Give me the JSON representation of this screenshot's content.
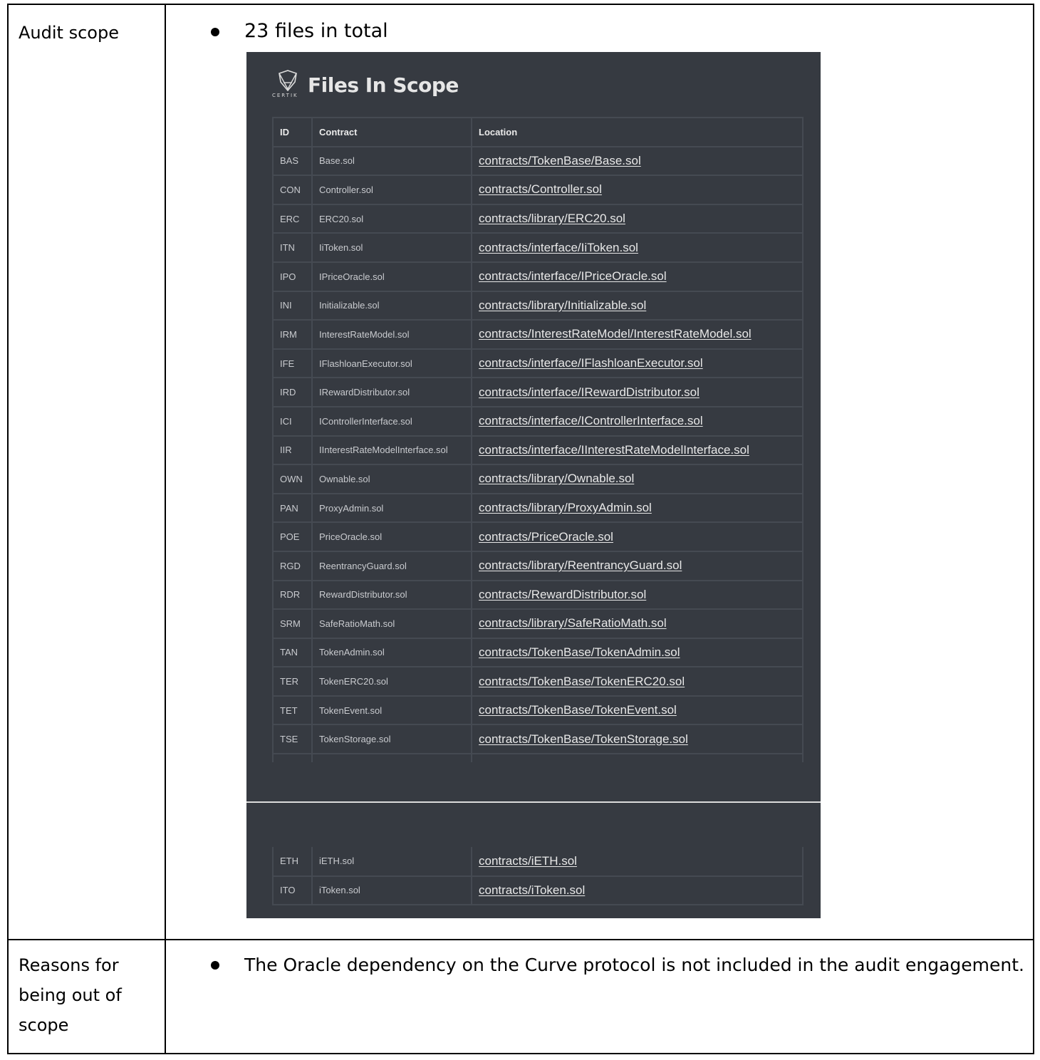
{
  "audit_scope": {
    "label": "Audit scope",
    "bullet": "23 files in total",
    "image": {
      "logo_text": "CERTIK",
      "title": "Files In Scope",
      "headers": [
        "ID",
        "Contract",
        "Location"
      ],
      "rows": [
        {
          "id": "BAS",
          "contract": "Base.sol",
          "location": "contracts/TokenBase/Base.sol"
        },
        {
          "id": "CON",
          "contract": "Controller.sol",
          "location": "contracts/Controller.sol"
        },
        {
          "id": "ERC",
          "contract": "ERC20.sol",
          "location": "contracts/library/ERC20.sol"
        },
        {
          "id": "ITN",
          "contract": "IiToken.sol",
          "location": "contracts/interface/IiToken.sol"
        },
        {
          "id": "IPO",
          "contract": "IPriceOracle.sol",
          "location": "contracts/interface/IPriceOracle.sol"
        },
        {
          "id": "INI",
          "contract": "Initializable.sol",
          "location": "contracts/library/Initializable.sol"
        },
        {
          "id": "IRM",
          "contract": "InterestRateModel.sol",
          "location": "contracts/InterestRateModel/InterestRateModel.sol"
        },
        {
          "id": "IFE",
          "contract": "IFlashloanExecutor.sol",
          "location": "contracts/interface/IFlashloanExecutor.sol"
        },
        {
          "id": "IRD",
          "contract": "IRewardDistributor.sol",
          "location": "contracts/interface/IRewardDistributor.sol"
        },
        {
          "id": "ICI",
          "contract": "IControllerInterface.sol",
          "location": "contracts/interface/IControllerInterface.sol"
        },
        {
          "id": "IIR",
          "contract": "IInterestRateModelInterface.sol",
          "location": "contracts/interface/IInterestRateModelInterface.sol"
        },
        {
          "id": "OWN",
          "contract": "Ownable.sol",
          "location": "contracts/library/Ownable.sol"
        },
        {
          "id": "PAN",
          "contract": "ProxyAdmin.sol",
          "location": "contracts/library/ProxyAdmin.sol"
        },
        {
          "id": "POE",
          "contract": "PriceOracle.sol",
          "location": "contracts/PriceOracle.sol"
        },
        {
          "id": "RGD",
          "contract": "ReentrancyGuard.sol",
          "location": "contracts/library/ReentrancyGuard.sol"
        },
        {
          "id": "RDR",
          "contract": "RewardDistributor.sol",
          "location": "contracts/RewardDistributor.sol"
        },
        {
          "id": "SRM",
          "contract": "SafeRatioMath.sol",
          "location": "contracts/library/SafeRatioMath.sol"
        },
        {
          "id": "TAN",
          "contract": "TokenAdmin.sol",
          "location": "contracts/TokenBase/TokenAdmin.sol"
        },
        {
          "id": "TER",
          "contract": "TokenERC20.sol",
          "location": "contracts/TokenBase/TokenERC20.sol"
        },
        {
          "id": "TET",
          "contract": "TokenEvent.sol",
          "location": "contracts/TokenBase/TokenEvent.sol"
        },
        {
          "id": "TSE",
          "contract": "TokenStorage.sol",
          "location": "contracts/TokenBase/TokenStorage.sol"
        }
      ],
      "rows_continued": [
        {
          "id": "ETH",
          "contract": "iETH.sol",
          "location": "contracts/iETH.sol"
        },
        {
          "id": "ITO",
          "contract": "iToken.sol",
          "location": "contracts/iToken.sol"
        }
      ]
    }
  },
  "out_of_scope": {
    "label": "Reasons for being out of scope",
    "bullet": "The Oracle dependency on the Curve protocol is not included in the audit engagement."
  }
}
